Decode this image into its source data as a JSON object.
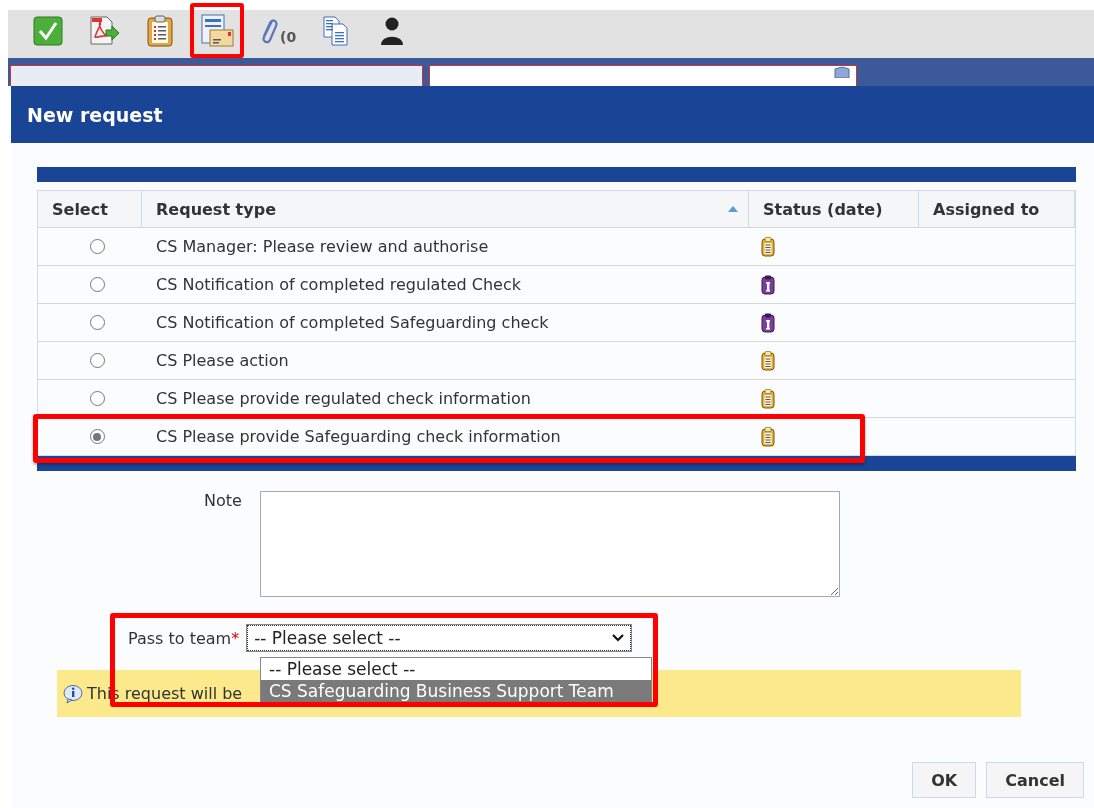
{
  "toolbar": [
    {
      "kind": "check",
      "highlighted": false
    },
    {
      "kind": "pdf",
      "highlighted": false
    },
    {
      "kind": "clipboard",
      "highlighted": false
    },
    {
      "kind": "form-mail",
      "highlighted": true
    },
    {
      "kind": "attachment",
      "label": "(0",
      "highlighted": false
    },
    {
      "kind": "copy",
      "highlighted": false
    },
    {
      "kind": "user",
      "highlighted": false
    }
  ],
  "background_tabs": [
    {
      "selected": false
    },
    {
      "selected": true
    }
  ],
  "dialog": {
    "title": "New request",
    "table": {
      "columns": [
        {
          "label": "Select",
          "sorted": false
        },
        {
          "label": "Request type",
          "sorted": true
        },
        {
          "label": "Status (date)",
          "sorted": false
        },
        {
          "label": "Assigned to",
          "sorted": false
        }
      ],
      "rows": [
        {
          "selected": false,
          "request_type": "CS Manager: Please review and authorise",
          "status": {
            "kind": "pending"
          },
          "highlighted": false
        },
        {
          "selected": false,
          "request_type": "CS Notification of completed regulated Check",
          "status": {
            "kind": "info"
          },
          "highlighted": false
        },
        {
          "selected": false,
          "request_type": "CS Notification of completed Safeguarding check",
          "status": {
            "kind": "info"
          },
          "highlighted": false
        },
        {
          "selected": false,
          "request_type": "CS Please action",
          "status": {
            "kind": "pending"
          },
          "highlighted": false
        },
        {
          "selected": false,
          "request_type": "CS Please provide regulated check information",
          "status": {
            "kind": "pending"
          },
          "highlighted": false
        },
        {
          "selected": true,
          "request_type": "CS Please provide Safeguarding check information",
          "status": {
            "kind": "pending"
          },
          "highlighted": true
        }
      ]
    },
    "note": {
      "label": "Note"
    },
    "team": {
      "label": "Pass to team",
      "required_mark": "*",
      "value": "-- Please select --",
      "open": true,
      "highlighted": true,
      "options": [
        {
          "label": "-- Please select --",
          "highlighted": false
        },
        {
          "label": "CS Safeguarding Business Support Team",
          "highlighted": true
        }
      ]
    },
    "info": {
      "text": "This request will be"
    },
    "buttons": [
      "OK",
      "Cancel"
    ]
  }
}
